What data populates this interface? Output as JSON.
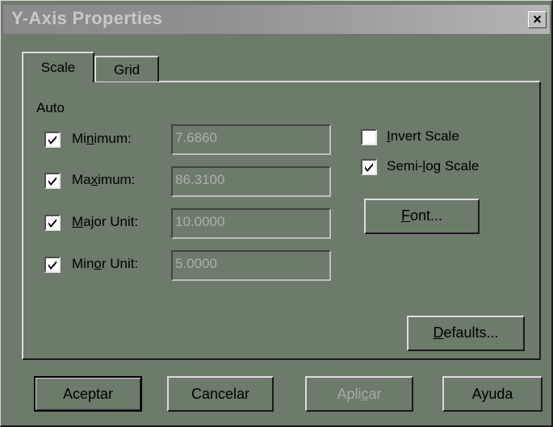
{
  "window": {
    "title": "Y-Axis Properties",
    "close_symbol": "×"
  },
  "tabs": [
    {
      "label": "Scale",
      "active": true
    },
    {
      "label": "Grid",
      "active": false
    }
  ],
  "scale": {
    "auto_label": "Auto",
    "rows": [
      {
        "prefix": "Mi",
        "mnemonic": "n",
        "suffix": "imum:",
        "value": "7.6860",
        "checked": true
      },
      {
        "prefix": "Ma",
        "mnemonic": "x",
        "suffix": "imum:",
        "value": "86.3100",
        "checked": true
      },
      {
        "prefix": "",
        "mnemonic": "M",
        "suffix": "ajor Unit:",
        "value": "10.0000",
        "checked": true
      },
      {
        "prefix": "Min",
        "mnemonic": "o",
        "suffix": "r Unit:",
        "value": "5.0000",
        "checked": true
      }
    ],
    "invert": {
      "prefix": "",
      "mnemonic": "I",
      "suffix": "nvert Scale",
      "checked": false
    },
    "semilog": {
      "prefix": "Semi-",
      "mnemonic": "l",
      "suffix": "og Scale",
      "checked": true
    },
    "font_button": {
      "prefix": "",
      "mnemonic": "F",
      "suffix": "ont..."
    },
    "defaults_button": {
      "prefix": "",
      "mnemonic": "D",
      "suffix": "efaults..."
    }
  },
  "footer": {
    "accept": "Aceptar",
    "cancel": "Cancelar",
    "apply": {
      "prefix": "Apli",
      "mnemonic": "c",
      "suffix": "ar",
      "enabled": false
    },
    "help": "Ayuda"
  },
  "colors": {
    "dialog_bg": "#6c7b6a",
    "disabled_text": "#a3ada1"
  }
}
